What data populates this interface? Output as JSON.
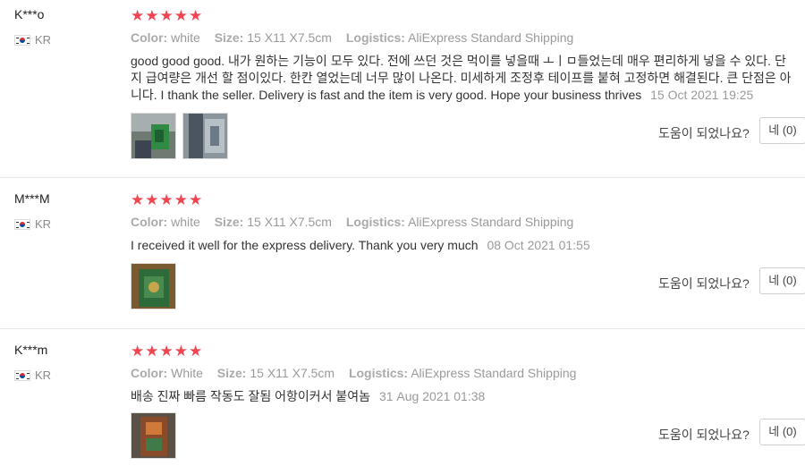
{
  "reviews": [
    {
      "user": "K***o",
      "country": "KR",
      "stars": "★★★★★",
      "rating": 5,
      "color_label": "Color:",
      "color_value": "white",
      "size_label": "Size:",
      "size_value": "15 X11 X7.5cm",
      "logistics_label": "Logistics:",
      "logistics_value": "AliExpress Standard Shipping",
      "text": "good good good. 내가 원하는 기능이 모두 있다. 전에 쓰던 것은 먹이를 넣을때 ㅗㅣㅁ들었는데 매우 편리하게 넣을 수 있다. 단지 급여량은 개선 할 점이있다. 한칸 열었는데 너무 많이 나온다. 미세하게 조정후 테이프를 붙혀 고정하면 해결된다. 큰 단점은 아니다. I thank the seller. Delivery is fast and the item is very good. Hope your business thrives",
      "date": "15 Oct 2021 19:25",
      "helpful_label": "도움이 되었나요?",
      "yes_label": "네 (0)"
    },
    {
      "user": "M***M",
      "country": "KR",
      "stars": "★★★★★",
      "rating": 5,
      "color_label": "Color:",
      "color_value": "white",
      "size_label": "Size:",
      "size_value": "15 X11 X7.5cm",
      "logistics_label": "Logistics:",
      "logistics_value": "AliExpress Standard Shipping",
      "text": "I received it well for the express delivery. Thank you very much",
      "date": "08 Oct 2021 01:55",
      "helpful_label": "도움이 되었나요?",
      "yes_label": "네 (0)"
    },
    {
      "user": "K***m",
      "country": "KR",
      "stars": "★★★★★",
      "rating": 5,
      "color_label": "Color:",
      "color_value": "White",
      "size_label": "Size:",
      "size_value": "15 X11 X7.5cm",
      "logistics_label": "Logistics:",
      "logistics_value": "AliExpress Standard Shipping",
      "text": "배송 진짜 빠름 작동도 잘됨 어항이커서 붙여놈",
      "date": "31 Aug 2021 01:38",
      "helpful_label": "도움이 되었나요?",
      "yes_label": "네 (0)"
    }
  ],
  "colors": {
    "star": "#f04651",
    "muted": "#9a9a9a",
    "divider": "#e8e8e8"
  }
}
